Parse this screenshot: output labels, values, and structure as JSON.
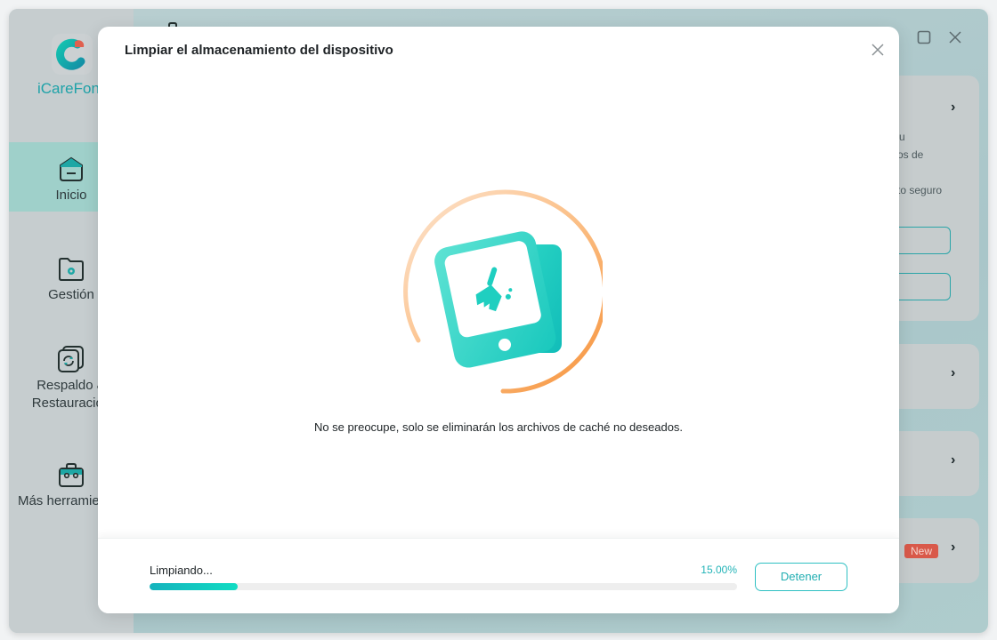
{
  "app": {
    "brand": "iCareFone",
    "brand_visible": "iCareFon",
    "accent_color": "#1ea2a8",
    "window_controls": [
      "minimize",
      "maximize",
      "close"
    ]
  },
  "sidebar": {
    "items": [
      {
        "label": "Inicio",
        "icon": "home-icon",
        "active": true
      },
      {
        "label": "Gestión",
        "icon": "folder-gear-icon",
        "active": false
      },
      {
        "label_line1": "Respaldo &",
        "label_line2": "Restauración",
        "icon": "backup-restore-icon",
        "active": false
      },
      {
        "label": "Más herramientas",
        "icon": "toolbox-icon",
        "active": false
      }
    ]
  },
  "background_panel": {
    "fragments": [
      "u",
      "os de",
      "to seguro"
    ],
    "badge": "New"
  },
  "dialog": {
    "title": "Limpiar el almacenamiento del dispositivo",
    "close_icon": "close-icon",
    "message": "No se preocupe, solo se eliminarán los archivos de caché no deseados.",
    "status": "Limpiando...",
    "progress_percent": 15.0,
    "progress_text": "15.00%",
    "stop_button": "Detener"
  }
}
